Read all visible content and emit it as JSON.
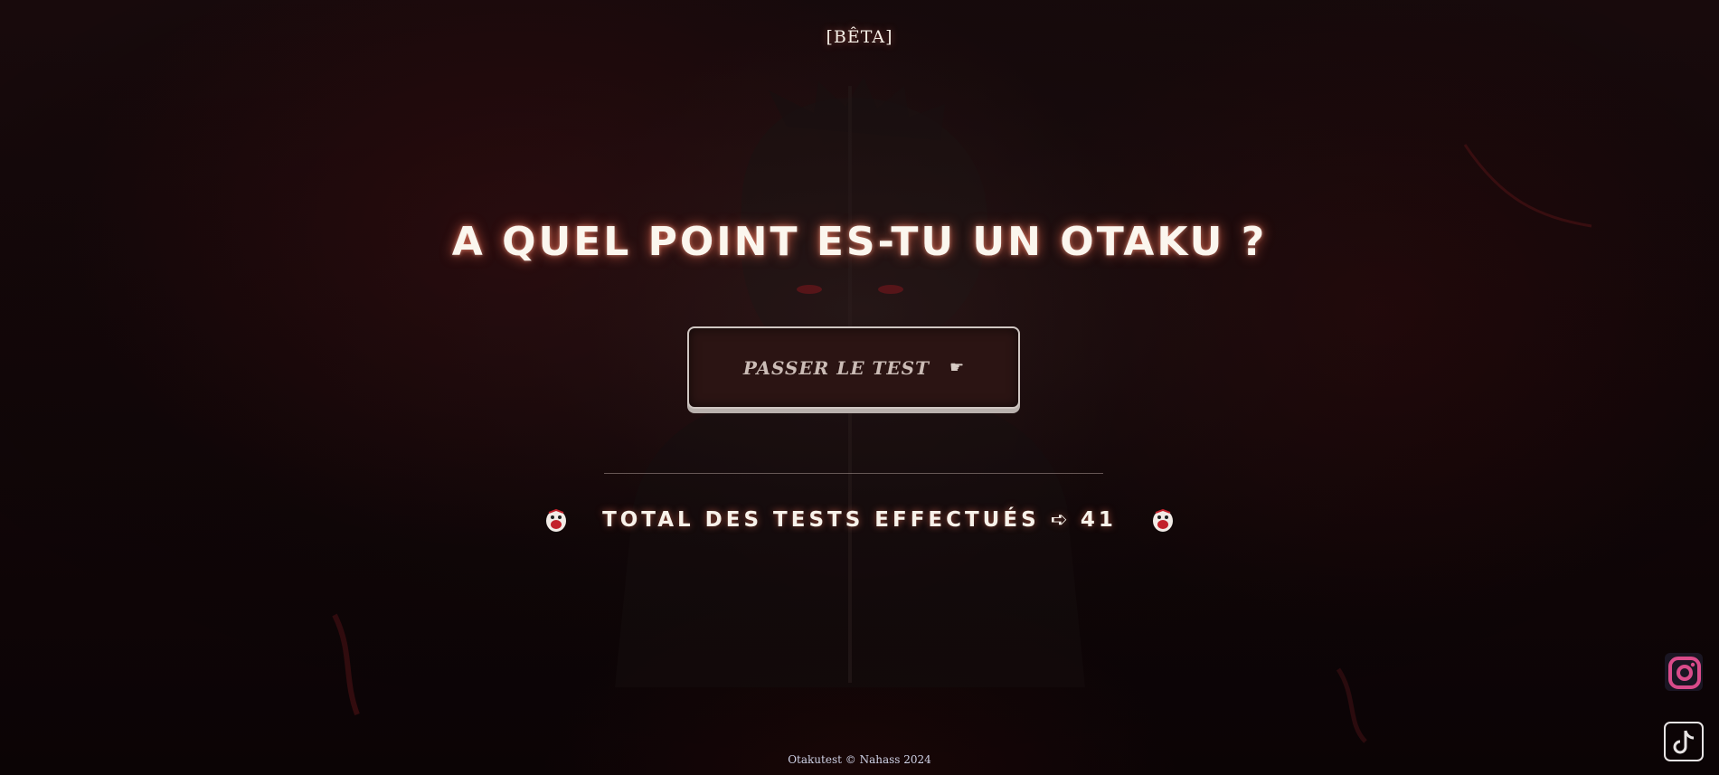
{
  "header": {
    "badge": "[BÊTA]"
  },
  "hero": {
    "title": "A QUEL POINT ES-TU UN OTAKU ?",
    "cta_label": "PASSER LE TEST",
    "cta_icon": "pointing-hand-icon"
  },
  "stats": {
    "label": "TOTAL DES TESTS EFFECTUÉS ➪",
    "count": "41",
    "left_icon": "mascot-icon",
    "right_icon": "mascot-icon"
  },
  "social": {
    "instagram_icon": "instagram-icon",
    "tiktok_icon": "tiktok-icon"
  },
  "footer": {
    "text": "Otakutest © Nahass 2024"
  },
  "colors": {
    "background": "#120608",
    "accent_glow": "#ff6e50",
    "button_bg": "#2b1413",
    "instagram": "#d94b8a"
  }
}
